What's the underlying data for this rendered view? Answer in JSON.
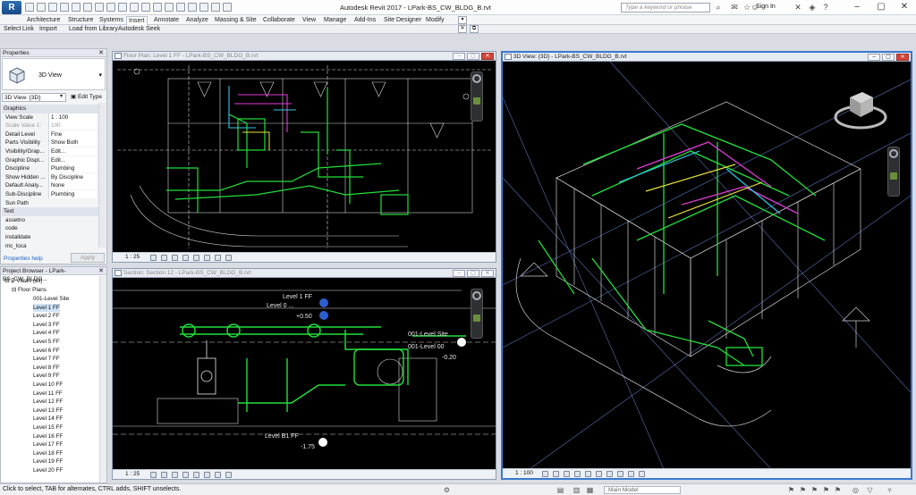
{
  "titlebar": {
    "app_button": "R",
    "title": "Autodesk Revit 2017 -    LPark-BS_CW_BLDG_B.rvt",
    "search_placeholder": "Type a keyword or phrase",
    "signin": "Sign In"
  },
  "ribbon": {
    "tabs": [
      "Architecture",
      "Structure",
      "Systems",
      "Insert",
      "Annotate",
      "Analyze",
      "Massing & Site",
      "Collaborate",
      "View",
      "Manage",
      "Add-Ins",
      "Site Designer",
      "Modify"
    ],
    "active_tab": "Insert",
    "panel_items": [
      "Select",
      "Link",
      "Import",
      "Load from Library",
      "Autodesk Seek"
    ]
  },
  "properties": {
    "header": "Properties",
    "type_name": "3D View",
    "view_selector": "3D View: {3D}",
    "edit_type": "Edit Type",
    "rows": [
      {
        "group": true,
        "k": "Graphics"
      },
      {
        "k": "View Scale",
        "v": "1 : 100"
      },
      {
        "k": "Scale Value    1:",
        "v": "100",
        "dim": true
      },
      {
        "k": "Detail Level",
        "v": "Fine"
      },
      {
        "k": "Parts Visibility",
        "v": "Show Both"
      },
      {
        "k": "Visibility/Grap...",
        "v": "Edit..."
      },
      {
        "k": "Graphic Displ...",
        "v": "Edit..."
      },
      {
        "k": "Discipline",
        "v": "Plumbing"
      },
      {
        "k": "Show Hidden ...",
        "v": "By Discipline"
      },
      {
        "k": "Default Analy...",
        "v": "None"
      },
      {
        "k": "Sub-Discipline",
        "v": "Plumbing"
      },
      {
        "k": "Sun Path",
        "v": ""
      },
      {
        "group": true,
        "k": "Text"
      },
      {
        "k": "assetno",
        "v": ""
      },
      {
        "k": "code",
        "v": ""
      },
      {
        "k": "installdate",
        "v": ""
      },
      {
        "k": "mc_loca",
        "v": ""
      }
    ],
    "help_link": "Properties help",
    "apply": "Apply"
  },
  "browser": {
    "header": "Project Browser - LPark-BS_CW_BLDG...",
    "root": "Views (all)",
    "group": "Floor Plans",
    "items": [
      "001-Level Site",
      "Level 1 FF",
      "Level 2 FF",
      "Level 3 FF",
      "Level 4 FF",
      "Level 5 FF",
      "Level 6 FF",
      "Level 7 FF",
      "Level 8 FF",
      "Level 9 FF",
      "Level 10 FF",
      "Level 11 FF",
      "Level 12 FF",
      "Level 13 FF",
      "Level 14 FF",
      "Level 15 FF",
      "Level 16 FF",
      "Level 17 FF",
      "Level 18 FF",
      "Level 19 FF",
      "Level 20 FF"
    ],
    "selected": "Level 1 FF"
  },
  "views": {
    "floor": {
      "title": "Floor Plan: Level 1 FF - LPark-BS_CW_BLDG_B.rvt",
      "scale": "1 : 25"
    },
    "section": {
      "title": "Section: Section 12 - LPark-BS_CW_BLDG_B.rvt",
      "scale": "1 : 25",
      "labels": [
        "Level 1 FF",
        "Level 0 ...",
        "+0.50",
        "001-Level Site",
        "001-Level 00",
        "-0.20",
        "Level B1 FF",
        "-1.75"
      ]
    },
    "threed": {
      "title": "3D View: {3D} - LPark-BS_CW_BLDG_B.rvt",
      "scale": "1 : 100"
    }
  },
  "statusbar": {
    "text": "Click to select, TAB for alternates, CTRL adds, SHIFT unselects.",
    "workset": "Main Model"
  },
  "colors": {
    "pipe_green": "#22e03a",
    "pipe_magenta": "#e23ad8",
    "pipe_cyan": "#2ec8e8",
    "pipe_yellow": "#e8e23a",
    "structure_white": "#d8d8d8",
    "accent_blue": "#1f5fbf"
  }
}
